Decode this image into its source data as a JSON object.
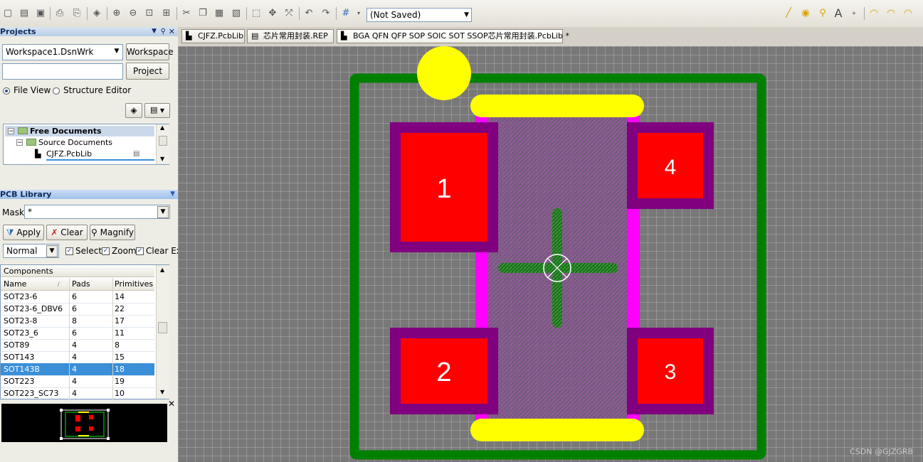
{
  "toolbar": {
    "combo_value": "(Not Saved)"
  },
  "projects_panel": {
    "title": "Projects",
    "workspace_value": "Workspace1.DsnWrk",
    "workspace_button": "Workspace",
    "project_value": "",
    "project_button": "Project",
    "file_view_label": "File View",
    "structure_editor_label": "Structure Editor",
    "tree": {
      "root": "Free Documents",
      "child": "Source Documents",
      "file": "CJFZ.PcbLib"
    }
  },
  "pcb_library": {
    "title": "PCB Library",
    "mask_label": "Mask",
    "mask_value": "*",
    "apply_label": "Apply",
    "clear_label": "Clear",
    "magnify_label": "Magnify",
    "mode_value": "Normal",
    "select_label": "Select",
    "zoom_label": "Zoom",
    "clear_existing_label": "Clear Exi",
    "components_header": "Components",
    "columns": [
      "Name",
      "Pads",
      "Primitives"
    ],
    "rows": [
      [
        "SOT23-6",
        "6",
        "14"
      ],
      [
        "SOT23-6_DBV6",
        "6",
        "22"
      ],
      [
        "SOT23-8",
        "8",
        "17"
      ],
      [
        "SOT23_6",
        "6",
        "11"
      ],
      [
        "SOT89",
        "4",
        "8"
      ],
      [
        "SOT143",
        "4",
        "15"
      ],
      [
        "SOT143B",
        "4",
        "18"
      ],
      [
        "SOT223",
        "4",
        "19"
      ],
      [
        "SOT223_SC73",
        "4",
        "10"
      ]
    ],
    "selected_row": 6
  },
  "tabs": [
    {
      "label": "CJFZ.PcbLib"
    },
    {
      "label": "芯片常用封装.REP"
    },
    {
      "label": "BGA QFN QFP SOP SOIC SOT SSOP芯片常用封装.PcbLib *"
    }
  ],
  "pcb": {
    "pads": [
      "1",
      "2",
      "3",
      "4"
    ],
    "colors": {
      "courtyard": "#008000",
      "silk": "#ffff00",
      "pad": "#ff0000",
      "solder_mask": "#800080",
      "body_outline": "#ff00ff"
    }
  },
  "watermark": "CSDN @GJZGRB"
}
